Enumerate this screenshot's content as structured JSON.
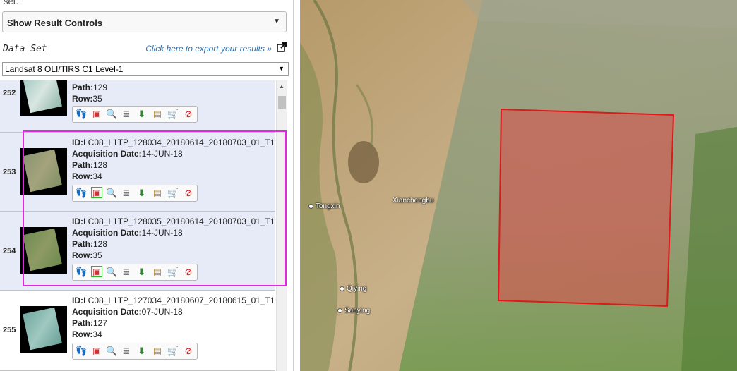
{
  "header": {
    "top_text": "set.",
    "result_controls_label": "Show Result Controls",
    "dataset_label": "Data Set",
    "export_link": "Click here to export your results »",
    "dataset_selected": "Landsat 8 OLI/TIRS C1 Level-1"
  },
  "labels": {
    "id": "ID:",
    "acq": "Acquisition Date:",
    "path": "Path:",
    "row": "Row:"
  },
  "results": [
    {
      "num": "252",
      "id": "",
      "acq": "",
      "path": "129",
      "row": "35"
    },
    {
      "num": "253",
      "id": "LC08_L1TP_128034_20180614_20180703_01_T1",
      "acq": "14-JUN-18",
      "path": "128",
      "row": "34"
    },
    {
      "num": "254",
      "id": "LC08_L1TP_128035_20180614_20180703_01_T1",
      "acq": "14-JUN-18",
      "path": "128",
      "row": "35"
    },
    {
      "num": "255",
      "id": "LC08_L1TP_127034_20180607_20180615_01_T1",
      "acq": "07-JUN-18",
      "path": "127",
      "row": "34"
    }
  ],
  "map": {
    "cities": [
      "Tongxin",
      "Xianchengbu",
      "Qiying",
      "Sanying"
    ]
  },
  "colors": {
    "selection_outline": "#e028e0",
    "footprint_fill": "#d9534f",
    "link": "#2a6fb0"
  }
}
